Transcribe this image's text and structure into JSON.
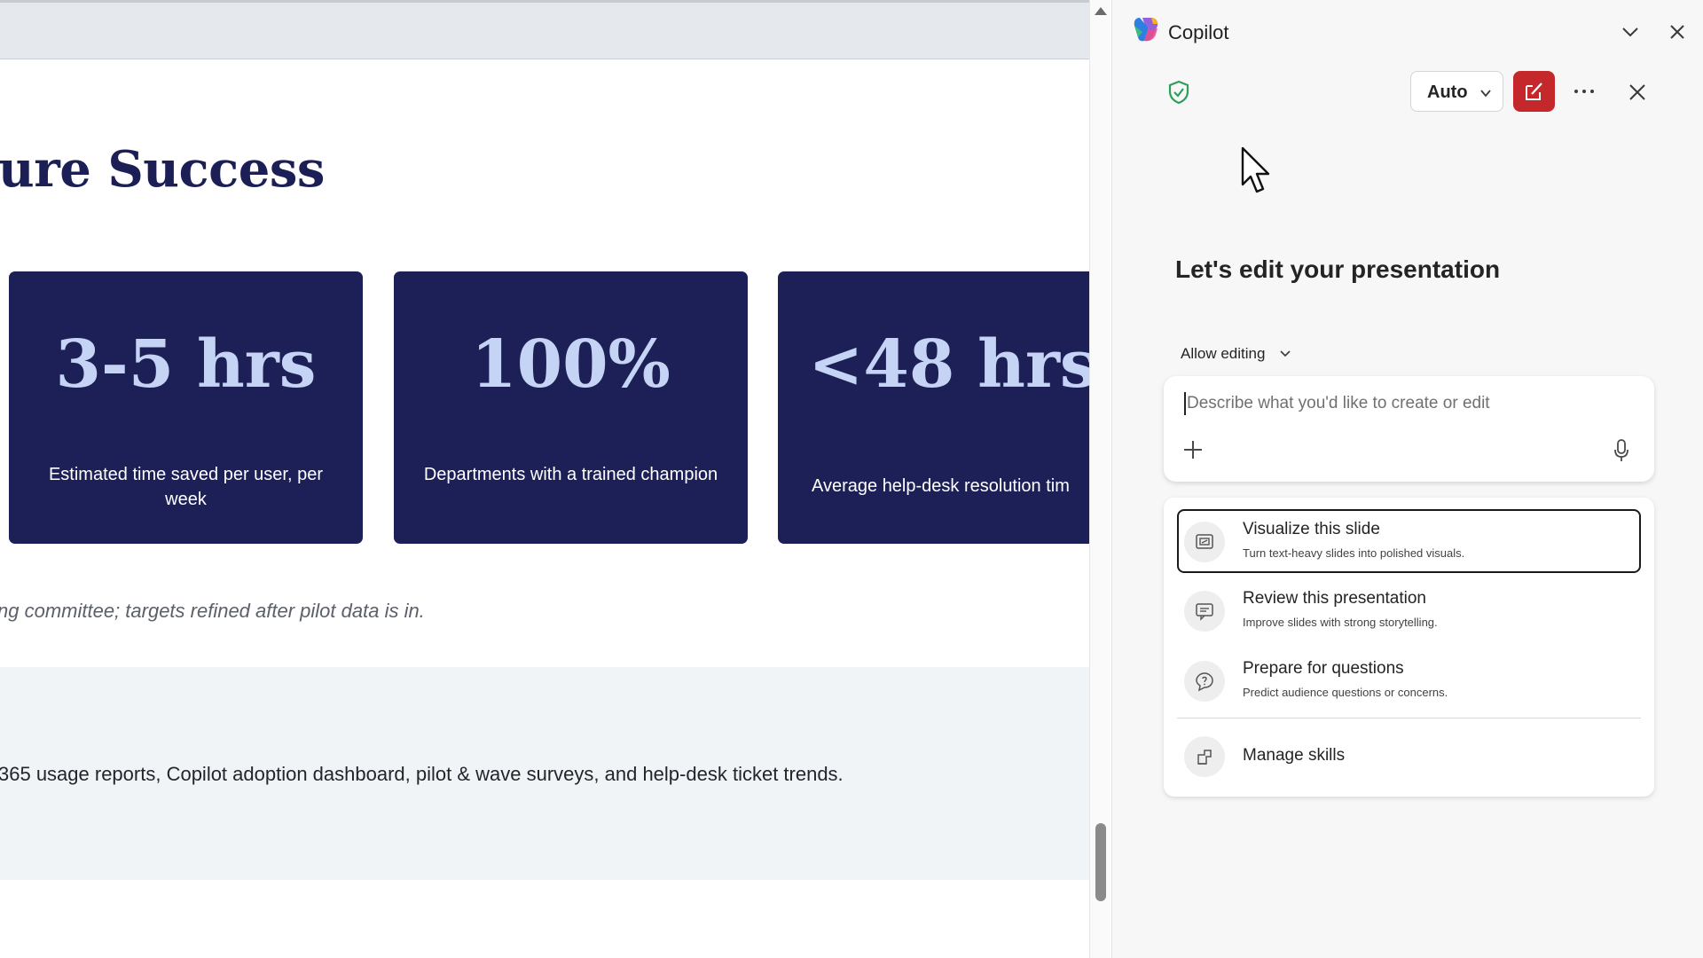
{
  "slide": {
    "title": "ure Success",
    "stats": [
      {
        "value": "3-5 hrs",
        "label": "Estimated time saved per user, per week"
      },
      {
        "value": "100%",
        "label": "Departments with a trained champion"
      },
      {
        "value": "<48 hrs",
        "label": "Average help-desk resolution tim"
      }
    ],
    "footnote": "ng committee; targets refined after pilot data is in.",
    "sources": "365 usage reports, Copilot adoption dashboard, pilot & wave surveys, and help-desk ticket trends."
  },
  "copilot": {
    "title": "Copilot",
    "mode": "Auto",
    "greeting": "Let's edit your presentation",
    "allow_editing": "Allow editing",
    "prompt_placeholder": "Describe what you'd like to create or edit",
    "skills": [
      {
        "title": "Visualize this slide",
        "desc": "Turn text-heavy slides into polished visuals.",
        "icon": "visualize-icon"
      },
      {
        "title": "Review this presentation",
        "desc": "Improve slides with strong storytelling.",
        "icon": "review-icon"
      },
      {
        "title": "Prepare for questions",
        "desc": "Predict audience questions or concerns.",
        "icon": "questions-icon"
      }
    ],
    "manage_skills": "Manage skills"
  },
  "colors": {
    "card_bg": "#1d2056",
    "stat_value": "#c5d3f5",
    "title": "#1b1f56",
    "new_chat_button": "#c4282a",
    "shield": "#2e9e5b"
  }
}
